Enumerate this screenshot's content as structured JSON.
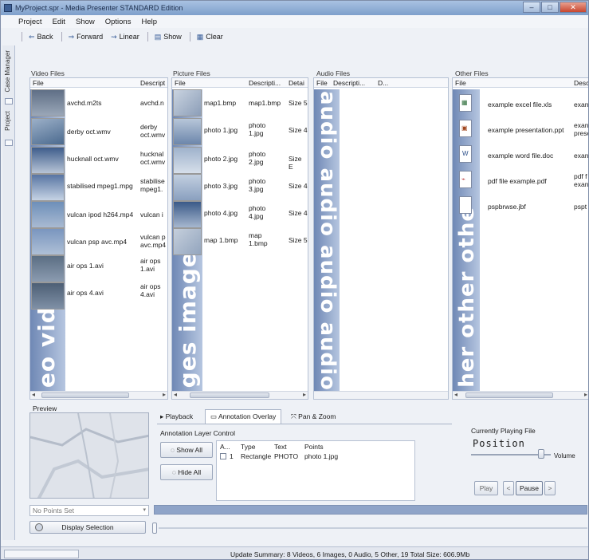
{
  "window": {
    "title": "MyProject.spr - Media Presenter STANDARD Edition"
  },
  "menu": [
    "Project",
    "Edit",
    "Show",
    "Options",
    "Help"
  ],
  "toolbar": {
    "back": "Back",
    "forward": "Forward",
    "linear": "Linear",
    "show": "Show",
    "clear": "Clear"
  },
  "sidebar": {
    "case_manager": "Case Manager",
    "project": "Project"
  },
  "video": {
    "title": "Video Files",
    "col_file": "File",
    "col_desc": "Descript",
    "watermark": "eo video",
    "rows": [
      {
        "name": "avchd.m2ts",
        "desc": "avchd.n"
      },
      {
        "name": "derby oct.wmv",
        "desc": "derby oct.wmv"
      },
      {
        "name": "hucknall oct.wmv",
        "desc": "hucknal oct.wmv"
      },
      {
        "name": "stabilised mpeg1.mpg",
        "desc": "stabilise mpeg1."
      },
      {
        "name": "vulcan ipod h264.mp4",
        "desc": "vulcan i"
      },
      {
        "name": "vulcan psp avc.mp4",
        "desc": "vulcan p avc.mp4"
      },
      {
        "name": "air ops 1.avi",
        "desc": "air ops 1.avi"
      },
      {
        "name": "air ops 4.avi",
        "desc": "air ops 4.avi"
      }
    ]
  },
  "picture": {
    "title": "Picture Files",
    "col_file": "File",
    "col_desc": "Descripti...",
    "col_detail": "Detai",
    "watermark": "ges image ir",
    "rows": [
      {
        "name": "map1.bmp",
        "desc": "map1.bmp",
        "detail": "Size 5"
      },
      {
        "name": "photo 1.jpg",
        "desc": "photo 1.jpg",
        "detail": "Size 4"
      },
      {
        "name": "photo 2.jpg",
        "desc": "photo 2.jpg",
        "detail": "Size E"
      },
      {
        "name": "photo 3.jpg",
        "desc": "photo 3.jpg",
        "detail": "Size 4"
      },
      {
        "name": "photo 4.jpg",
        "desc": "photo 4.jpg",
        "detail": "Size 4"
      },
      {
        "name": "map 1.bmp",
        "desc": "map 1.bmp",
        "detail": "Size 5"
      }
    ]
  },
  "audio": {
    "title": "Audio Files",
    "col_file": "File",
    "col_desc": "Descripti...",
    "col_d": "D...",
    "watermark": "audio audio audio audio"
  },
  "other": {
    "title": "Other Files",
    "col_file": "File",
    "col_desc": "Desc",
    "watermark": "her other othe",
    "rows": [
      {
        "name": "example excel file.xls",
        "desc": "exan",
        "icon": "excel-file-icon"
      },
      {
        "name": "example presentation.ppt",
        "desc": "exan prese",
        "icon": "presentation-file-icon"
      },
      {
        "name": "example word file.doc",
        "desc": "exan",
        "icon": "word-file-icon"
      },
      {
        "name": "pdf file example.pdf",
        "desc": "pdf f exan",
        "icon": "pdf-file-icon"
      },
      {
        "name": "pspbrwse.jbf",
        "desc": "pspt",
        "icon": "file-icon"
      }
    ]
  },
  "preview": {
    "label": "Preview"
  },
  "tabs": {
    "playback": "Playback",
    "annotation": "Annotation Overlay",
    "pan_zoom": "Pan & Zoom"
  },
  "annotation": {
    "group_label": "Annotation Layer Control",
    "show_all": "Show All",
    "hide_all": "Hide All",
    "headers": [
      "A...",
      "Type",
      "Text",
      "Points"
    ],
    "rows": [
      {
        "id": "1",
        "type": "Rectangle",
        "text": "PHOTO",
        "points": "photo 1.jpg"
      }
    ]
  },
  "player": {
    "label": "Currently Playing File",
    "position": "Position",
    "volume": "Volume",
    "play": "Play",
    "prev": "<",
    "pause": "Pause",
    "next": ">"
  },
  "points_select": {
    "value": "No Points Set"
  },
  "display_selection": "Display Selection",
  "status": {
    "summary": "Update Summary: 8 Videos, 6 Images, 0 Audio, 5 Other, 19 Total Size: 606.9Mb"
  },
  "colors": {
    "title_bar": "#7e9fcb",
    "watermark_fill": "#8ea2c7",
    "progress_bar": "#8fa4c8"
  }
}
